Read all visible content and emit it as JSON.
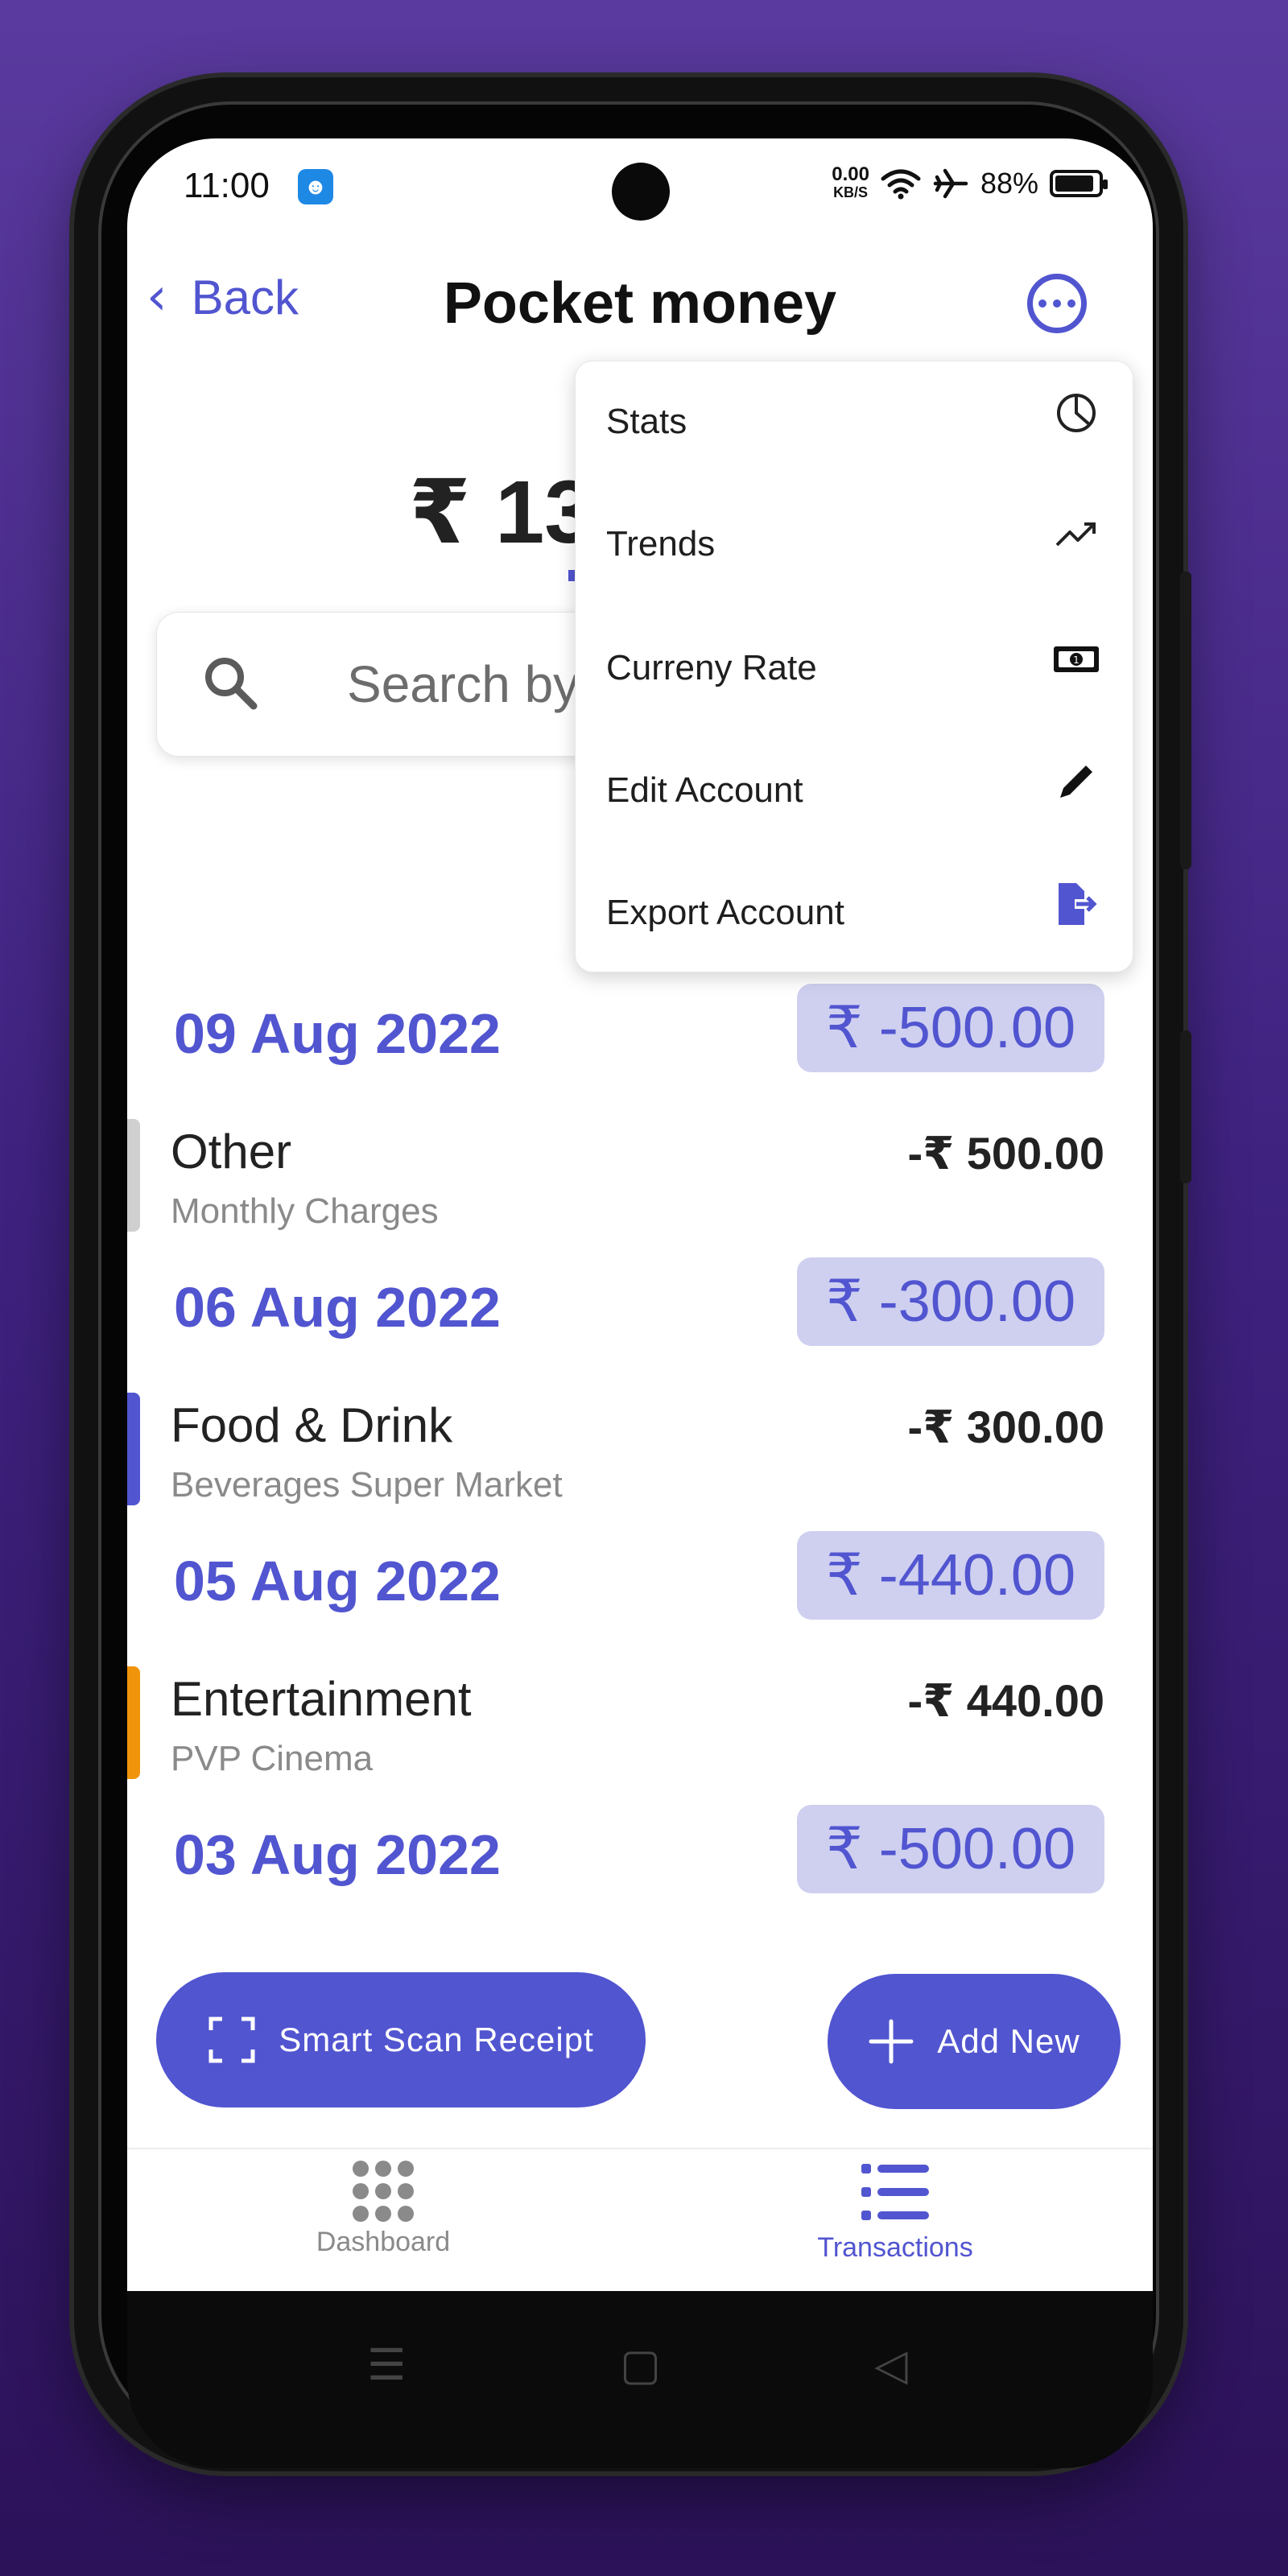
{
  "status_bar": {
    "time": "11:00",
    "net_speed_value": "0.00",
    "net_speed_unit": "KB/S",
    "battery": "88%",
    "battery_level": 0.88
  },
  "header": {
    "back_label": "Back",
    "title": "Pocket money",
    "more_icon": "more-horizontal-circle-icon"
  },
  "balance": {
    "text": "₹ 13"
  },
  "search": {
    "placeholder": "Search by C"
  },
  "menu": {
    "items": [
      {
        "label": "Stats",
        "icon": "pie-chart-icon"
      },
      {
        "label": "Trends",
        "icon": "trending-up-icon"
      },
      {
        "label": "Curreny Rate",
        "icon": "banknote-icon"
      },
      {
        "label": "Edit Account",
        "icon": "pencil-icon"
      },
      {
        "label": "Export Account",
        "icon": "file-export-icon"
      }
    ]
  },
  "transactions": {
    "days": [
      {
        "date": "09 Aug 2022",
        "total": "₹ -500.00"
      },
      {
        "date": "06 Aug 2022",
        "total": "₹ -300.00"
      },
      {
        "date": "05 Aug 2022",
        "total": "₹ -440.00"
      },
      {
        "date": "03 Aug 2022",
        "total": "₹ -500.00"
      }
    ],
    "items": [
      {
        "category": "Other",
        "description": "Monthly Charges",
        "amount": "-₹ 500.00",
        "color": "#d0d0d0"
      },
      {
        "category": "Food & Drink",
        "description": "Beverages Super Market",
        "amount": "-₹ 300.00",
        "color": "#5155d0"
      },
      {
        "category": "Entertainment",
        "description": "PVP Cinema",
        "amount": "-₹ 440.00",
        "color": "#f0940c"
      }
    ]
  },
  "actions": {
    "scan_label": "Smart Scan Receipt",
    "add_label": "Add New"
  },
  "tabs": {
    "dashboard_label": "Dashboard",
    "transactions_label": "Transactions"
  },
  "colors": {
    "accent": "#5155d0",
    "accent_light": "#cfd0f0"
  }
}
